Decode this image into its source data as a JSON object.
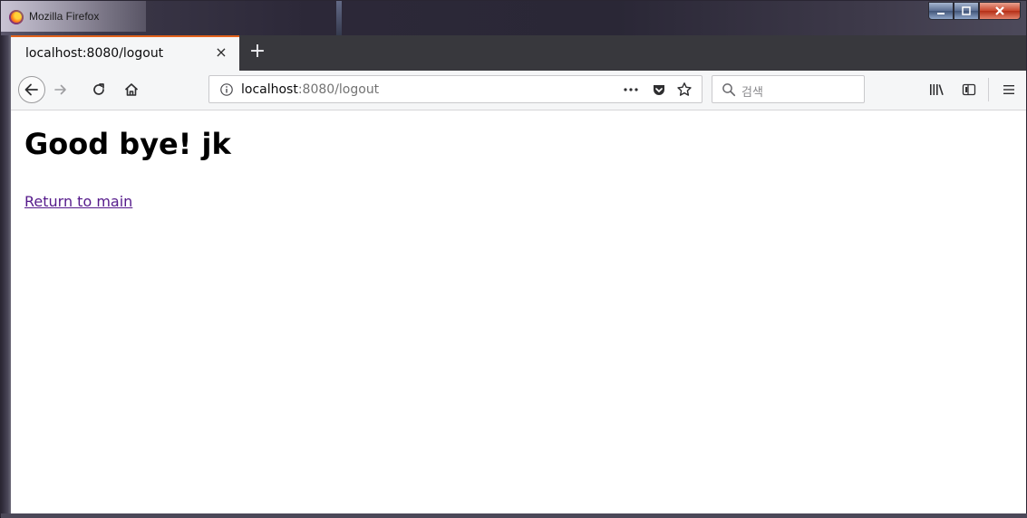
{
  "window": {
    "title": "Mozilla Firefox"
  },
  "tabs": [
    {
      "label": "localhost:8080/logout",
      "close": "×",
      "active": true
    }
  ],
  "new_tab_label": "+",
  "urlbar": {
    "host": "localhost",
    "path": ":8080/logout"
  },
  "search": {
    "placeholder": "검색"
  },
  "page": {
    "heading": "Good bye! jk",
    "link": "Return to main"
  },
  "colors": {
    "tab_accent": "#e2621b",
    "visited_link": "#551a8b",
    "tabstrip_bg": "#38383d"
  },
  "icons": {
    "app": "firefox-logo-icon",
    "back": "back-arrow-icon",
    "forward": "forward-arrow-icon",
    "reload": "reload-icon",
    "home": "home-icon",
    "info": "site-info-icon",
    "page_actions": "ellipsis-icon",
    "pocket": "pocket-icon",
    "bookmark": "bookmark-star-icon",
    "search": "search-icon",
    "library": "library-icon",
    "sidebar": "sidebar-icon",
    "menu": "hamburger-menu-icon"
  }
}
